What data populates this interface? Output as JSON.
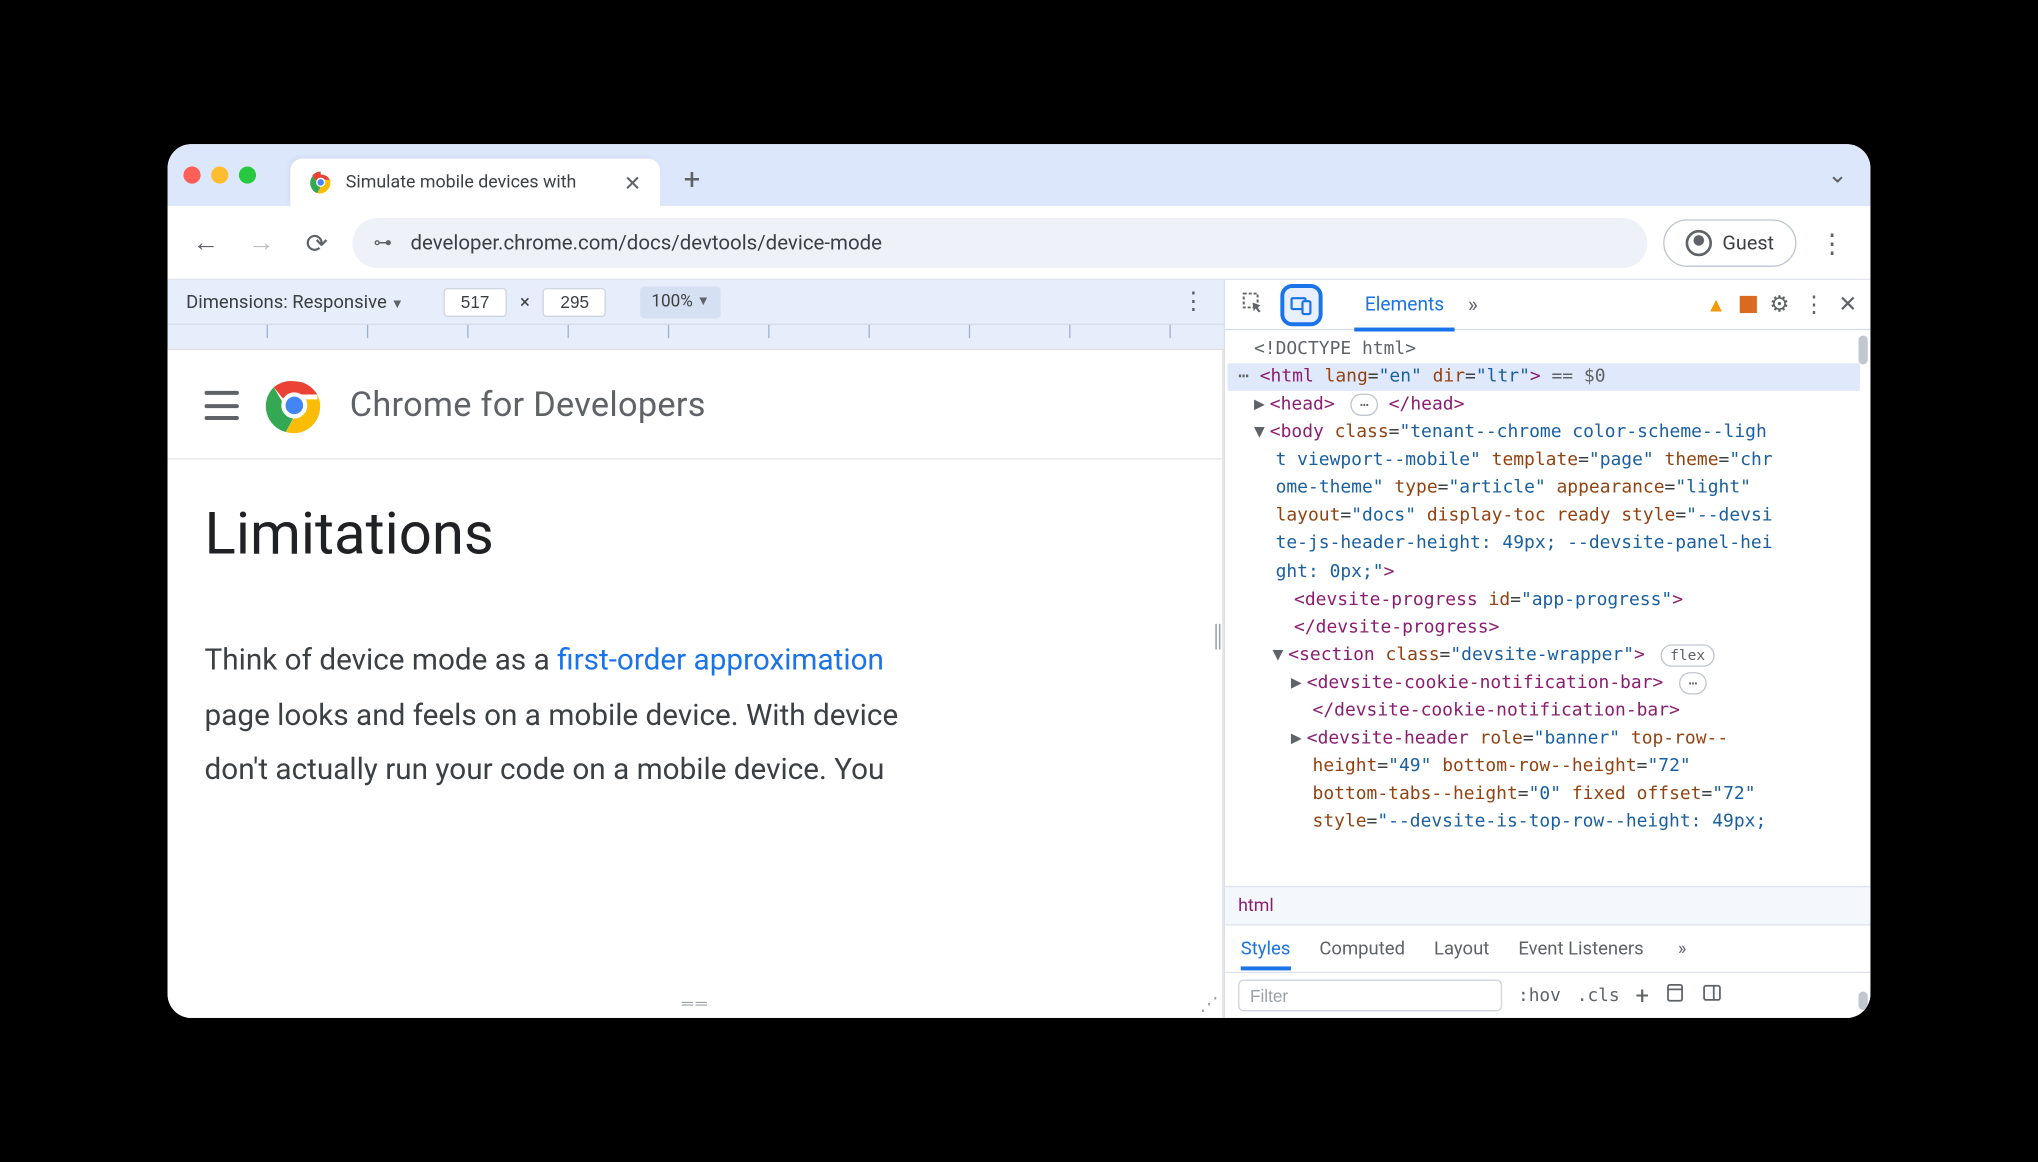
{
  "tab": {
    "title": "Simulate mobile devices with"
  },
  "urlbar": {
    "url": "developer.chrome.com/docs/devtools/device-mode"
  },
  "profile": {
    "label": "Guest"
  },
  "device_bar": {
    "label": "Dimensions: Responsive",
    "width": "517",
    "height": "295",
    "times": "×",
    "zoom": "100%"
  },
  "page": {
    "brand": "Chrome for Developers",
    "h1": "Limitations",
    "p1a": "Think of device mode as a ",
    "link": "first-order approximation",
    "p1b": " page looks and feels on a mobile device. With device",
    "p1c": "don't actually run your code on a mobile device. You"
  },
  "devtools": {
    "tab_elements": "Elements",
    "breadcrumb": "html",
    "dom": {
      "doctype": "<!DOCTYPE html>",
      "html_open": "<html lang=\"en\" dir=\"ltr\">",
      "eq0": " == $0",
      "head": "<head> ⋯ </head>",
      "body_open": "<body class=\"tenant--chrome color-scheme--light viewport--mobile\" template=\"page\" theme=\"chrome-theme\" type=\"article\" appearance=\"light\" layout=\"docs\" display-toc ready style=\"--devsite-js-header-height: 49px; --devsite-panel-height: 0px;\">",
      "prog": "<devsite-progress id=\"app-progress\"></devsite-progress>",
      "section_open": "<section class=\"devsite-wrapper\">",
      "cookie": "<devsite-cookie-notification-bar> ⋯ </devsite-cookie-notification-bar>",
      "header": "<devsite-header role=\"banner\" top-row--height=\"49\" bottom-row--height=\"72\" bottom-tabs--height=\"0\" fixed offset=\"72\" style=\"--devsite-js-top-row--height: 49px;"
    },
    "sub_tabs": {
      "styles": "Styles",
      "computed": "Computed",
      "layout": "Layout",
      "events": "Event Listeners"
    },
    "filter": {
      "placeholder": "Filter",
      "hov": ":hov",
      "cls": ".cls"
    }
  }
}
